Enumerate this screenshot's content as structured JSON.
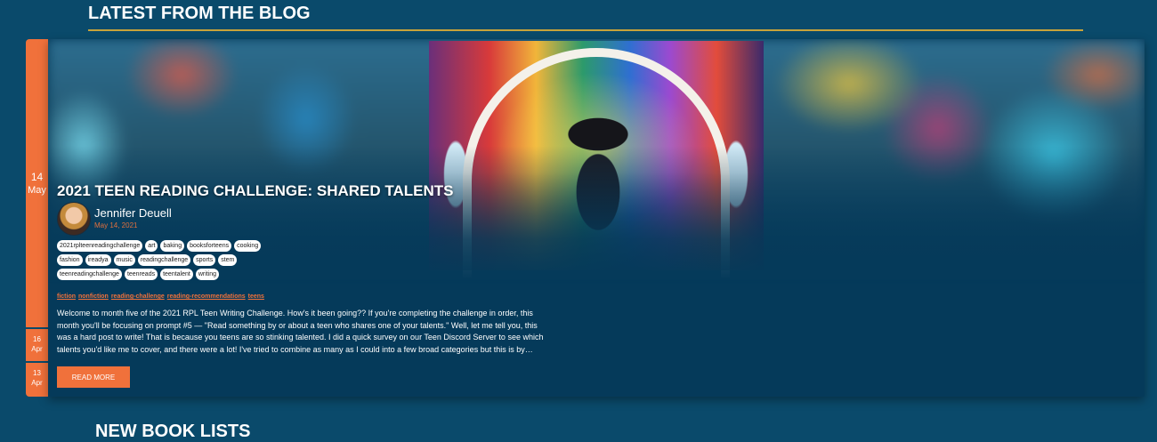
{
  "section_title": "LATEST FROM THE BLOG",
  "colors": {
    "accent": "#f0713b",
    "rule": "#c7a33a",
    "background": "#0a4a6b",
    "card": "#053a5a"
  },
  "dates": [
    {
      "day": "14",
      "month": "May",
      "active": true
    },
    {
      "day": "16",
      "month": "Apr",
      "active": false
    },
    {
      "day": "13",
      "month": "Apr",
      "active": false
    }
  ],
  "post": {
    "title": "2021 TEEN READING CHALLENGE: SHARED TALENTS",
    "author": "Jennifer Deuell",
    "date": "May 14, 2021",
    "tags": [
      "2021rplteenreadingchallenge",
      "art",
      "baking",
      "booksforteens",
      "cooking",
      "fashion",
      "ireadya",
      "music",
      "readingchallenge",
      "sports",
      "stem",
      "teenreadingchallenge",
      "teenreads",
      "teentalent",
      "writing"
    ],
    "categories": [
      "fiction",
      "nonfiction",
      "reading-challenge",
      "reading-recommendations",
      "teens"
    ],
    "excerpt": "Welcome to month five of the 2021 RPL Teen Writing Challenge. How's it been going?? If you're completing the challenge in order, this month you'll be focusing on prompt #5 — \"Read something by or about a teen who shares one of your talents.\" Well, let me tell you, this was a hard post to write! That is because you teens are so stinking talented. I did a quick survey on our Teen Discord Server to see which talents you'd like me to cover, and there were a lot! I've tried to combine as many as I could into a few broad categories but this is by…",
    "read_more_label": "READ MORE"
  },
  "next_section_title": "NEW BOOK LISTS"
}
